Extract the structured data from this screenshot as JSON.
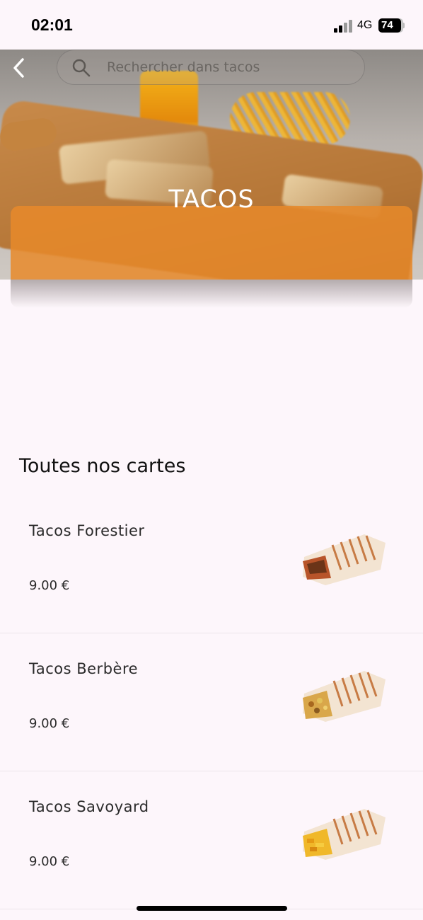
{
  "status_bar": {
    "time": "02:01",
    "network": "4G",
    "battery": "74"
  },
  "header": {
    "search_placeholder": "Rechercher dans tacos",
    "back_icon": "chevron-left-icon",
    "search_icon": "search-icon"
  },
  "hero": {
    "title": "TACOS",
    "banner_color": "#e88a2a"
  },
  "section": {
    "title": "Toutes nos cartes"
  },
  "menu": {
    "items": [
      {
        "name": "Tacos Forestier",
        "price": "9.00 €"
      },
      {
        "name": "Tacos Berbère",
        "price": "9.00 €"
      },
      {
        "name": "Tacos Savoyard",
        "price": "9.00 €"
      }
    ]
  }
}
